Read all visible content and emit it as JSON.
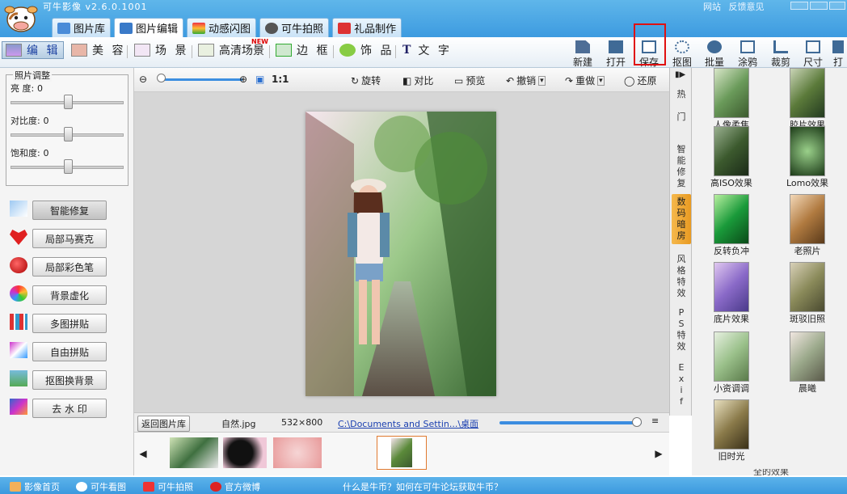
{
  "app": {
    "title": "可牛影像 v2.6.0.1001",
    "links": [
      "网站",
      "反馈意见"
    ]
  },
  "tabs": [
    "图片库",
    "图片编辑",
    "动感闪图",
    "可牛拍照",
    "礼品制作"
  ],
  "modes": [
    "编 辑",
    "美 容",
    "场 景",
    "高清场景",
    "边 框",
    "饰 品",
    "文 字"
  ],
  "mode_badge": "NEW",
  "tools": [
    "新建",
    "打开",
    "保存",
    "抠图",
    "批量",
    "涂鸦",
    "裁剪",
    "尺寸",
    "打"
  ],
  "adjust": {
    "title": "照片调整",
    "sliders": [
      {
        "label": "亮  度:",
        "value": "0"
      },
      {
        "label": "对比度:",
        "value": "0"
      },
      {
        "label": "饱和度:",
        "value": "0"
      }
    ]
  },
  "features": [
    "智能修复",
    "局部马赛克",
    "局部彩色笔",
    "背景虚化",
    "多图拼贴",
    "自由拼贴",
    "抠图换背景",
    "去 水 印"
  ],
  "canvas_controls": {
    "zoom_reset": "1:1",
    "rotate": "旋转",
    "compare": "对比",
    "preview": "预览",
    "undo": "撤销",
    "redo": "重做",
    "restore": "还原"
  },
  "info": {
    "back": "返回图片库",
    "filename": "自然.jpg",
    "size": "532×800",
    "path": "C:\\Documents and Settin...\\桌面"
  },
  "categories": [
    "热\n\n门",
    "智\n能\n修\n复",
    "数\n码\n暗\n房",
    "风\n格\n特\n效",
    "P\nS\n特\n效",
    "E\nx\ni\nf"
  ],
  "effects": [
    "人像柔焦",
    "胶片效果",
    "高ISO效果",
    "Lomo效果",
    "反转负冲",
    "老照片",
    "底片效果",
    "斑驳旧照",
    "小资调调",
    "晨曦",
    "旧时光"
  ],
  "effects_footer": "全的效果",
  "status": {
    "items": [
      "影像首页",
      "可牛看图",
      "可牛拍照",
      "官方微博"
    ],
    "message": "什么是牛币？如何在可牛论坛获取牛币？"
  }
}
